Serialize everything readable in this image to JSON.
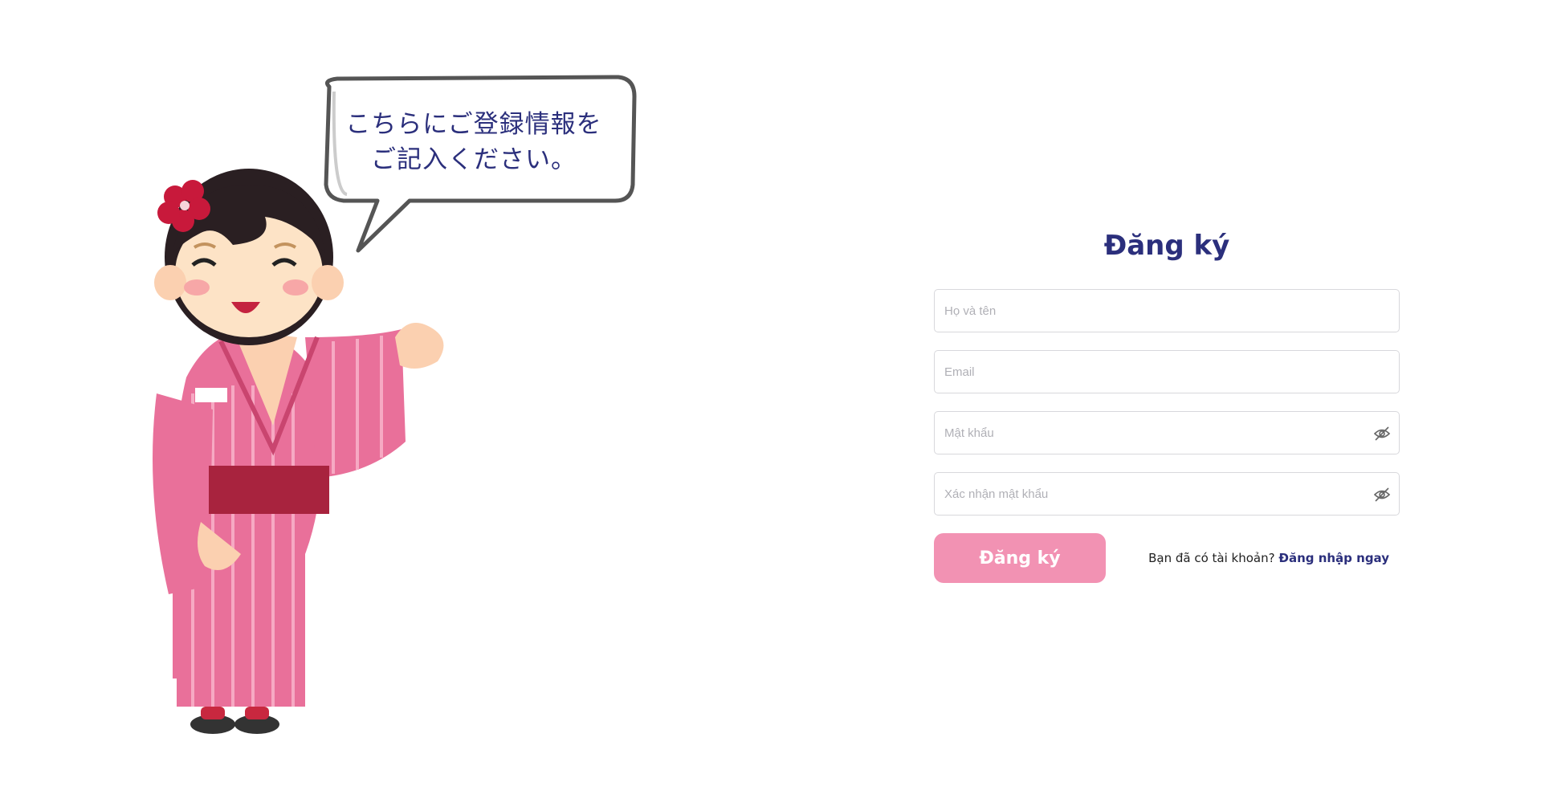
{
  "speech_bubble": {
    "line1": "こちらにご登録情報を",
    "line2": "ご記入ください。"
  },
  "form": {
    "title": "Đăng ký",
    "fullname_placeholder": "Họ và tên",
    "email_placeholder": "Email",
    "password_placeholder": "Mật khẩu",
    "confirm_placeholder": "Xác nhận mật khẩu",
    "password_toggle_icon": "eye-slash-icon",
    "submit_label": "Đăng ký",
    "login_prompt": "Bạn đã có tài khoản?",
    "login_link": "Đăng nhập ngay"
  },
  "colors": {
    "accent": "#2b2f7c",
    "button": "#f292b3",
    "kimono": "#e9709a"
  }
}
